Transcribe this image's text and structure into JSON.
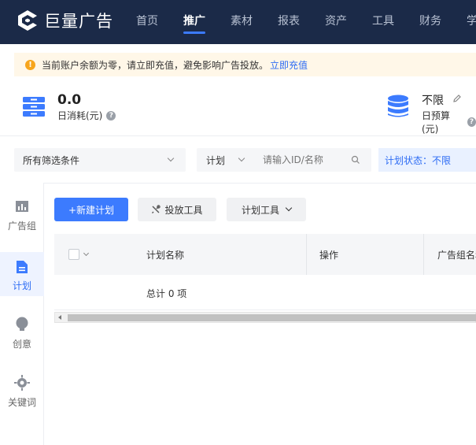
{
  "brand": {
    "name": "巨量广告"
  },
  "nav": {
    "items": [
      {
        "label": "首页"
      },
      {
        "label": "推广"
      },
      {
        "label": "素材"
      },
      {
        "label": "报表"
      },
      {
        "label": "资产"
      },
      {
        "label": "工具"
      },
      {
        "label": "财务"
      },
      {
        "label": "学"
      }
    ],
    "active_index": 1
  },
  "notice": {
    "icon": "warning-icon",
    "text": "当前账户余额为零，请立即充值，避免影响广告投放。",
    "link": "立即充值"
  },
  "stats": {
    "daily_spend": {
      "value": "0.0",
      "label": "日消耗(元)"
    },
    "daily_budget": {
      "value": "不限",
      "label": "日预算(元)"
    }
  },
  "filters": {
    "all_conditions": "所有筛选条件",
    "scope_select": "计划",
    "search_placeholder": "请输入ID/名称",
    "status": "计划状态：不限"
  },
  "sidebar": {
    "items": [
      {
        "label": "广告组",
        "icon": "bar-chart-icon"
      },
      {
        "label": "计划",
        "icon": "document-icon"
      },
      {
        "label": "创意",
        "icon": "lightbulb-icon"
      },
      {
        "label": "关键词",
        "icon": "target-icon"
      }
    ],
    "active_index": 1
  },
  "toolbar": {
    "new_plan": "+新建计划",
    "delivery_tools": "投放工具",
    "plan_tools": "计划工具"
  },
  "table": {
    "columns": [
      "计划名称",
      "操作",
      "广告组名称"
    ],
    "total_text": "总计 0 项"
  },
  "colors": {
    "nav_bg": "#1b2a48",
    "accent": "#3c7bfe",
    "link": "#2d6cf4",
    "notice_bg": "#fff7e8",
    "warning": "#f7a51c"
  }
}
